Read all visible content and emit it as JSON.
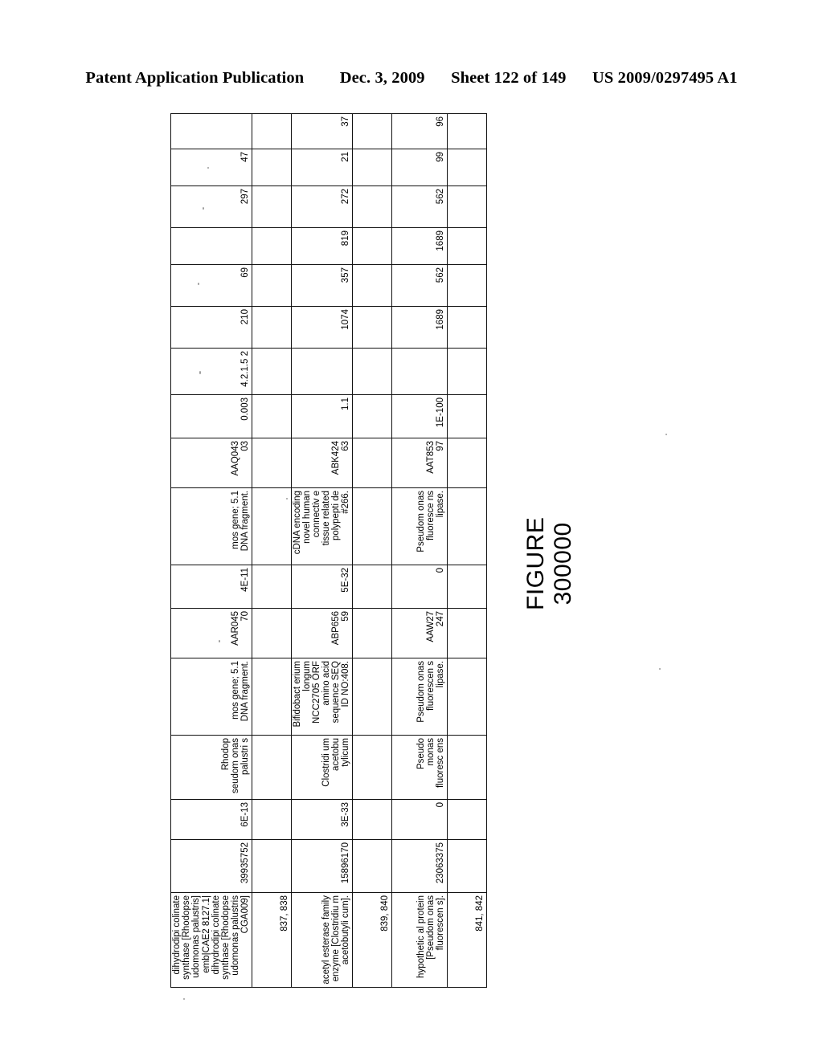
{
  "header": {
    "publication": "Patent Application Publication",
    "date": "Dec. 3, 2009",
    "sheet": "Sheet 122 of 149",
    "patent_number": "US 2009/0297495 A1"
  },
  "figure": {
    "caption_line1": "FIGURE",
    "caption_line2": "300000"
  },
  "table": {
    "columns": [
      "description",
      "gi_number",
      "evalue_1",
      "organism_1",
      "definition_1",
      "accession_1",
      "evalue_2",
      "definition_2",
      "accession_2",
      "score",
      "ec_number",
      "num_1",
      "num_2",
      "num_3",
      "num_4",
      "num_5",
      "num_6"
    ],
    "rows": [
      {
        "row_label": "837,\n838",
        "description": "dihydrodipi colinate synthase [Rhodopse udomonas palustris] emb|CAE2 8127.1| dihydrodipi colinate synthase [Rhodopse udomonas palustris CGA009]",
        "gi_number": "39935752",
        "evalue_1": "6E-13",
        "organism_1": "Rhodop seudom onas palustri s",
        "definition_1": "mos gene; 5.1 DNA fragment.",
        "accession_1": "AAR045 70",
        "evalue_2": "4E-11",
        "definition_2": "mos gene; 5.1 DNA fragment.",
        "accession_2": "AAQ043 03",
        "score": "0.003",
        "ec_number": "4.2.1.5 2",
        "num_1": "210",
        "num_2": "69",
        "num_3": "",
        "num_4": "297",
        "num_5": "47",
        "num_6": ""
      },
      {
        "row_label": "839,\n840",
        "description": "acetyl esterase family enzyme [Clostridiu m acetobutyli cum].",
        "gi_number": "15896170",
        "evalue_1": "3E-33",
        "organism_1": "Clostridi um acetobu tylicum",
        "definition_1": "Bifidobact erium longum NCC2705 ORF amino acid sequence SEQ ID NO:408.",
        "accession_1": "ABP656 59",
        "evalue_2": "5E-32",
        "definition_2": "cDNA encoding novel human connectiv e tissue related polypepti de #266.",
        "accession_2": "ABK424 63",
        "score": "1.1",
        "ec_number": "",
        "num_1": "1074",
        "num_2": "357",
        "num_3": "819",
        "num_4": "272",
        "num_5": "21",
        "num_6": "37"
      },
      {
        "row_label": "841,\n842",
        "description": "hypothetic al protein [Pseudom onas fluorescen s].",
        "gi_number": "23063375",
        "evalue_1": "0",
        "organism_1": "Pseudo monas fluoresc ens",
        "definition_1": "Pseudom onas fluorescen s lipase.",
        "accession_1": "AAW27 247",
        "evalue_2": "0",
        "definition_2": "Pseudom onas fluoresce ns lipase.",
        "accession_2": "AAT853 97",
        "score": "1E-100",
        "ec_number": "",
        "num_1": "1689",
        "num_2": "562",
        "num_3": "1689",
        "num_4": "562",
        "num_5": "99",
        "num_6": "96"
      }
    ]
  }
}
